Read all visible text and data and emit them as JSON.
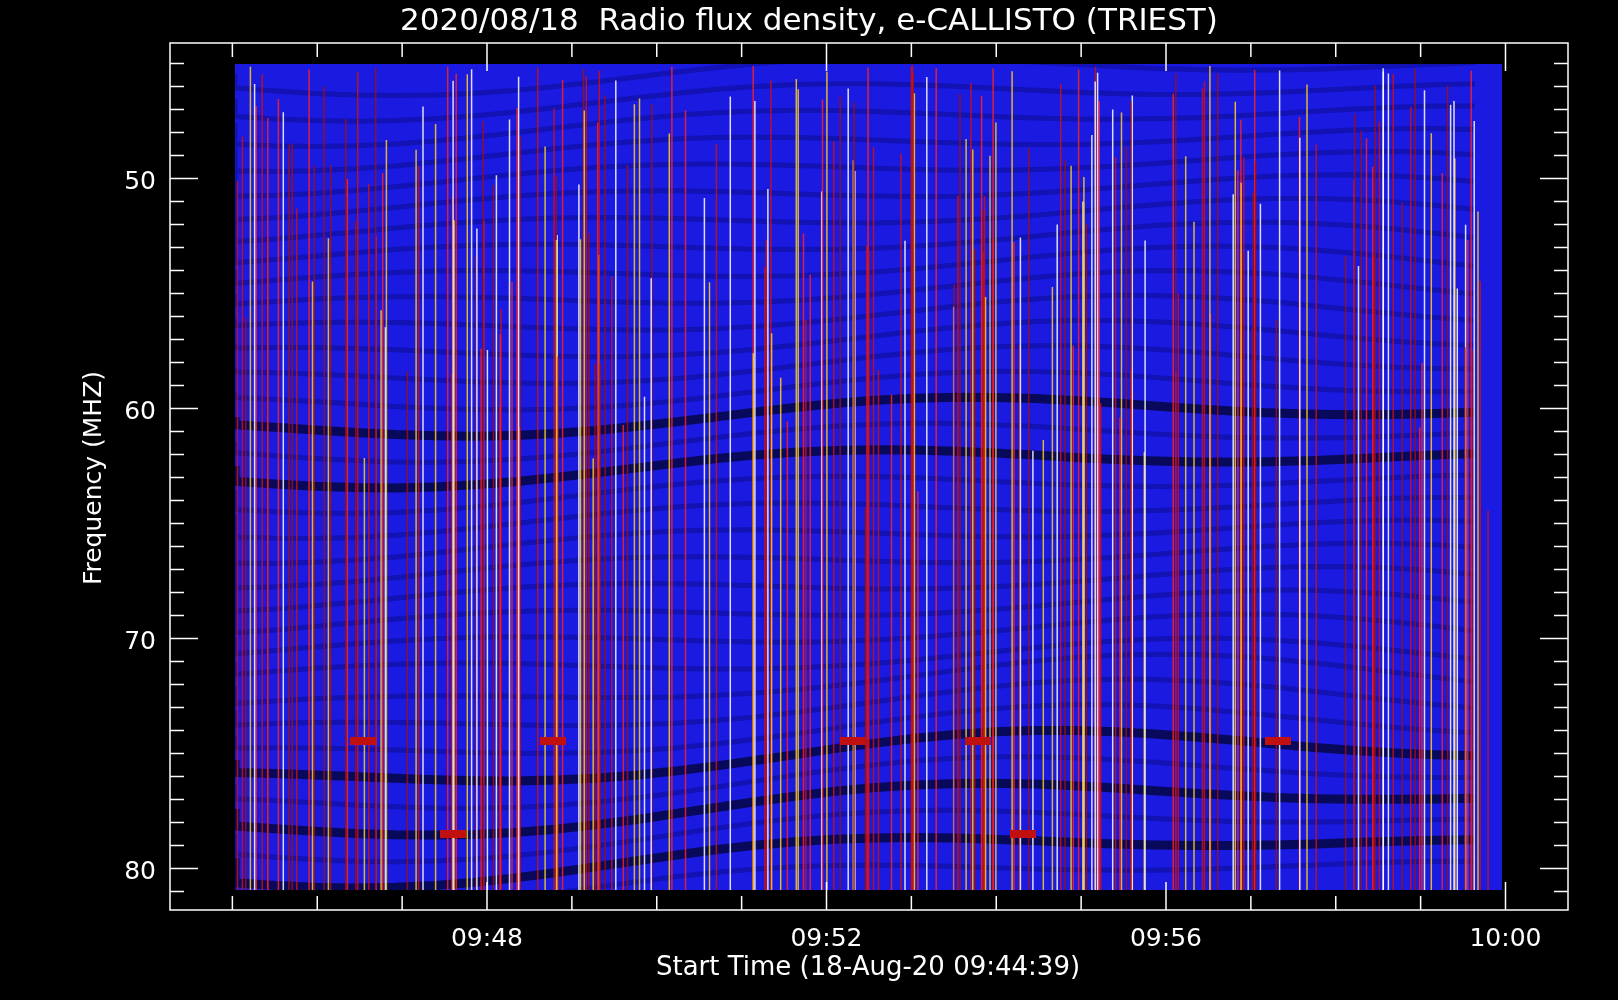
{
  "title": "2020/08/18  Radio flux density, e-CALLISTO (TRIEST)",
  "y_axis": {
    "label": "Frequency (MHZ)",
    "ticks": [
      "50",
      "60",
      "70",
      "80"
    ]
  },
  "x_axis": {
    "label": "Start Time (18-Aug-20 09:44:39)",
    "ticks": [
      "09:48",
      "09:52",
      "09:56",
      "10:00"
    ]
  }
}
